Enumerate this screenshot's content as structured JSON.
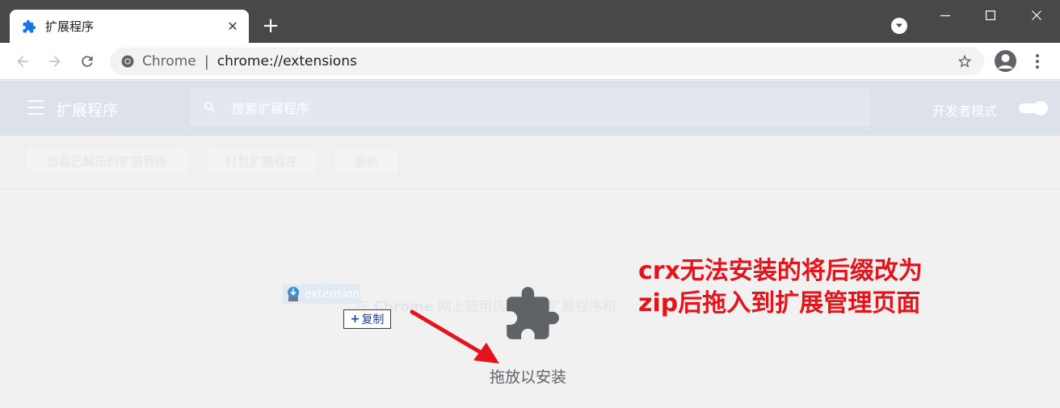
{
  "browser": {
    "tab": {
      "title": "扩展程序",
      "close_glyph": "✕"
    },
    "new_tab_glyph": "+",
    "omnibox": {
      "site_label": "Chrome",
      "separator": "|",
      "url": "chrome://extensions"
    }
  },
  "extensions_page": {
    "title": "扩展程序",
    "search_placeholder": "搜索扩展程序",
    "developer_mode_label": "开发者模式",
    "developer_mode_on": true,
    "actions": {
      "load_unpacked": "加载已解压的扩展程序",
      "pack": "打包扩展程序",
      "update": "更新"
    }
  },
  "drop_zone": {
    "background_text_prefix": "在",
    "background_text_brand": "Chrome",
    "background_text_rest": "网上应用店中查找扩展程序和",
    "label": "拖放以安装"
  },
  "drag": {
    "file_name": "extension",
    "copy_label": "复制",
    "copy_plus": "+"
  },
  "annotation": {
    "line1": "crx无法安装的将后缀改为",
    "line2": "zip后拖入到扩展管理页面",
    "color": "#e3141b"
  },
  "colors": {
    "titlebar": "#4a4846",
    "accent": "#1a73e8",
    "annotation_red": "#e3141b"
  }
}
